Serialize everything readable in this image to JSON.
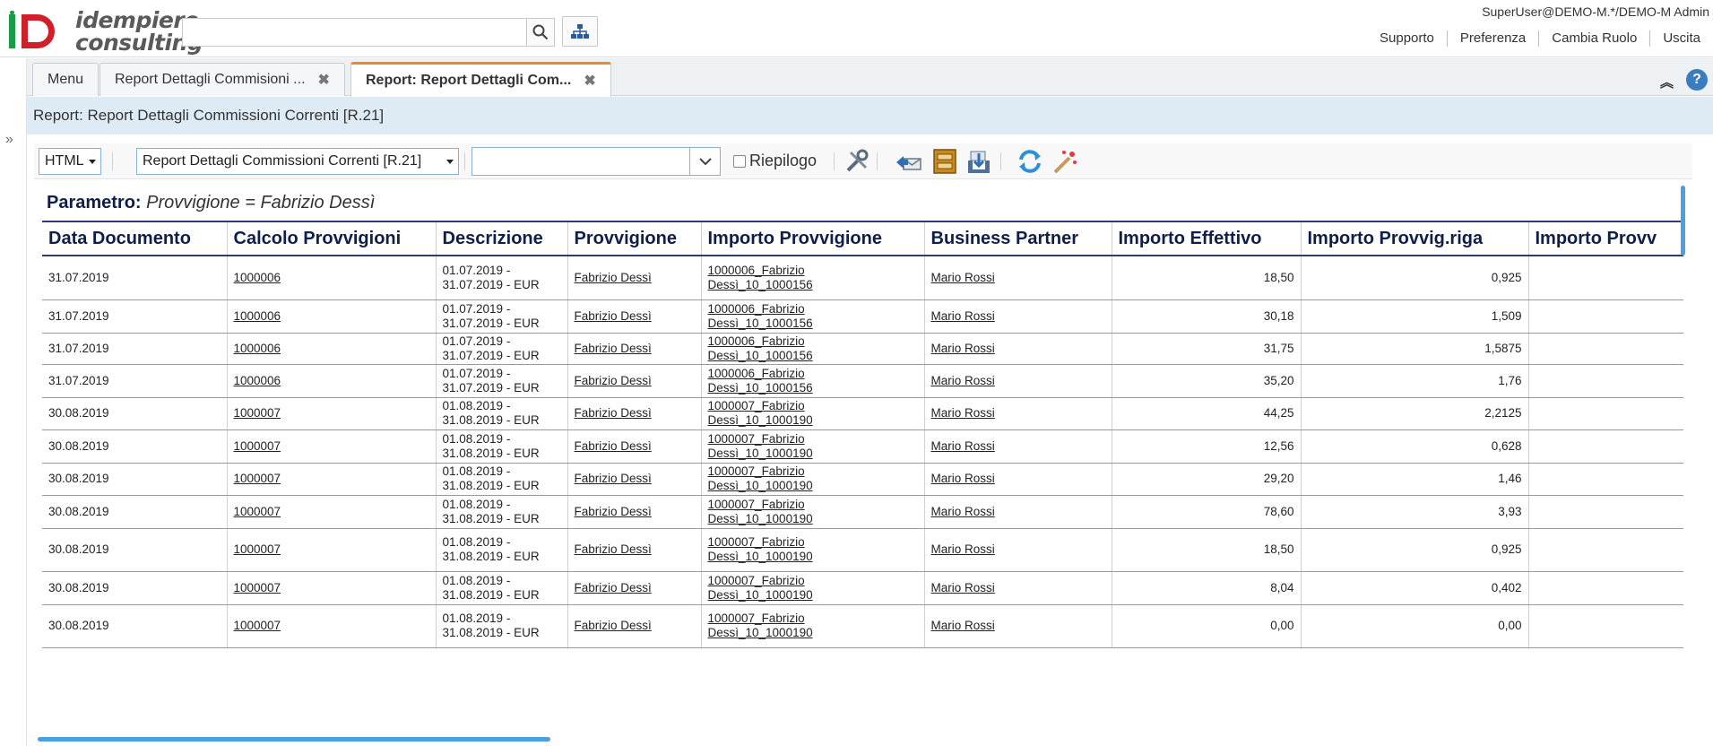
{
  "header": {
    "logo_line1": "idempiere",
    "logo_line2": "consulting",
    "search_value": "",
    "user": "SuperUser@DEMO-M.*/DEMO-M Admin",
    "links": [
      "Supporto",
      "Preferenza",
      "Cambia Ruolo",
      "Uscita"
    ]
  },
  "tabs": [
    {
      "label": "Menu",
      "closable": false
    },
    {
      "label": "Report Dettagli Commisioni ...",
      "closable": true
    },
    {
      "label": "Report: Report Dettagli Com...",
      "closable": true,
      "active": true
    }
  ],
  "title": "Report: Report Dettagli Commissioni Correnti [R.21]",
  "toolbar": {
    "format": "HTML",
    "report_view": "Report Dettagli Commissioni Correnti [R.21]",
    "print_format": "",
    "summary_label": "Riepilogo",
    "summary_checked": false,
    "icons": [
      "customize-icon",
      "send-icon",
      "archive-icon",
      "export-icon",
      "refresh-icon",
      "wizard-icon"
    ]
  },
  "report": {
    "param_label": "Parametro:",
    "param_value": "Provvigione = Fabrizio Dessì",
    "columns": [
      "Data Documento",
      "Calcolo Provvigioni",
      "Descrizione",
      "Provvigione",
      "Importo Provvigione",
      "Business Partner",
      "Importo Effettivo",
      "Importo Provvig.riga",
      "Importo Provv"
    ],
    "rows": [
      [
        "31.07.2019",
        "1000006",
        [
          "01.07.2019 -",
          "31.07.2019 - EUR"
        ],
        "Fabrizio Dessì",
        [
          "1000006_Fabrizio",
          "Dessì_10_1000156"
        ],
        "Mario Rossi",
        "18,50",
        "0,925",
        ""
      ],
      [
        "31.07.2019",
        "1000006",
        [
          "01.07.2019 -",
          "31.07.2019 - EUR"
        ],
        "Fabrizio Dessì",
        [
          "1000006_Fabrizio",
          "Dessì_10_1000156"
        ],
        "Mario Rossi",
        "30,18",
        "1,509",
        ""
      ],
      [
        "31.07.2019",
        "1000006",
        [
          "01.07.2019 -",
          "31.07.2019 - EUR"
        ],
        "Fabrizio Dessì",
        [
          "1000006_Fabrizio",
          "Dessì_10_1000156"
        ],
        "Mario Rossi",
        "31,75",
        "1,5875",
        ""
      ],
      [
        "31.07.2019",
        "1000006",
        [
          "01.07.2019 -",
          "31.07.2019 - EUR"
        ],
        "Fabrizio Dessì",
        [
          "1000006_Fabrizio",
          "Dessì_10_1000156"
        ],
        "Mario Rossi",
        "35,20",
        "1,76",
        ""
      ],
      [
        "30.08.2019",
        "1000007",
        [
          "01.08.2019 -",
          "31.08.2019 - EUR"
        ],
        "Fabrizio Dessì",
        [
          "1000007_Fabrizio",
          "Dessì_10_1000190"
        ],
        "Mario Rossi",
        "44,25",
        "2,2125",
        ""
      ],
      [
        "30.08.2019",
        "1000007",
        [
          "01.08.2019 -",
          "31.08.2019 - EUR"
        ],
        "Fabrizio Dessì",
        [
          "1000007_Fabrizio",
          "Dessì_10_1000190"
        ],
        "Mario Rossi",
        "12,56",
        "0,628",
        ""
      ],
      [
        "30.08.2019",
        "1000007",
        [
          "01.08.2019 -",
          "31.08.2019 - EUR"
        ],
        "Fabrizio Dessì",
        [
          "1000007_Fabrizio",
          "Dessì_10_1000190"
        ],
        "Mario Rossi",
        "29,20",
        "1,46",
        ""
      ],
      [
        "30.08.2019",
        "1000007",
        [
          "01.08.2019 -",
          "31.08.2019 - EUR"
        ],
        "Fabrizio Dessì",
        [
          "1000007_Fabrizio",
          "Dessì_10_1000190"
        ],
        "Mario Rossi",
        "78,60",
        "3,93",
        ""
      ],
      [
        "30.08.2019",
        "1000007",
        [
          "01.08.2019 -",
          "31.08.2019 - EUR"
        ],
        "Fabrizio Dessì",
        [
          "1000007_Fabrizio",
          "Dessì_10_1000190"
        ],
        "Mario Rossi",
        "18,50",
        "0,925",
        ""
      ],
      [
        "30.08.2019",
        "1000007",
        [
          "01.08.2019 -",
          "31.08.2019 - EUR"
        ],
        "Fabrizio Dessì",
        [
          "1000007_Fabrizio",
          "Dessì_10_1000190"
        ],
        "Mario Rossi",
        "8,04",
        "0,402",
        ""
      ],
      [
        "30.08.2019",
        "1000007",
        [
          "01.08.2019 -",
          "31.08.2019 - EUR"
        ],
        "Fabrizio Dessì",
        [
          "1000007_Fabrizio",
          "Dessì_10_1000190"
        ],
        "Mario Rossi",
        "0,00",
        "0,00",
        ""
      ]
    ]
  },
  "colors": {
    "accent_tab": "#ef8a1f",
    "title_bg": "#deebf5",
    "header_text": "#0f1f4a",
    "logo_green": "#1a9b4a",
    "logo_red": "#d0202b",
    "scroll": "#4a9fe0"
  }
}
